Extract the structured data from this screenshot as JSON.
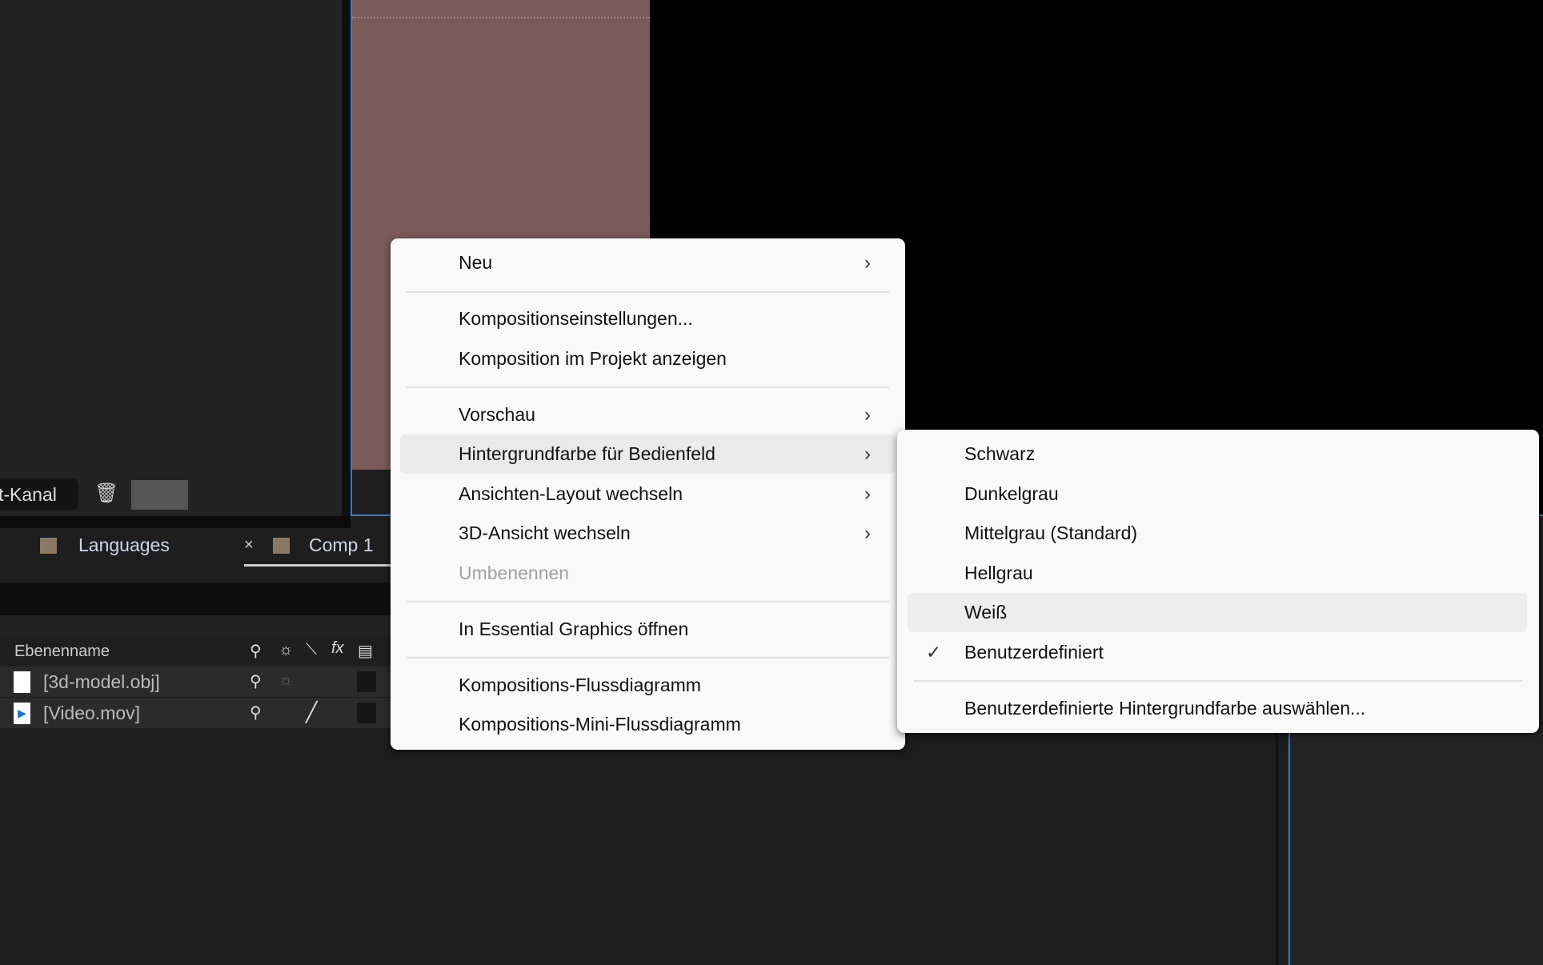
{
  "left_panel": {
    "channel_button": "t-Kanal",
    "trash_icon": "trash-icon"
  },
  "tabs": [
    {
      "label": "Languages",
      "color": "#8a7a63"
    },
    {
      "label": "Comp 1",
      "color": "#8a7a63",
      "close": "×",
      "active": true
    }
  ],
  "timeline": {
    "column_header": "Ebenenname",
    "layers": [
      {
        "name": "[3d-model.obj]",
        "icon": "file-icon"
      },
      {
        "name": "[Video.mov]",
        "icon": "video-file-icon"
      }
    ]
  },
  "context_menu": {
    "items": [
      {
        "label": "Neu",
        "submenu": true
      },
      {
        "label": "Kompositionseinstellungen..."
      },
      {
        "label": "Komposition im Projekt anzeigen"
      },
      {
        "label": "Vorschau",
        "submenu": true
      },
      {
        "label": "Hintergrundfarbe für Bedienfeld",
        "submenu": true,
        "highlighted": true
      },
      {
        "label": "Ansichten-Layout wechseln",
        "submenu": true
      },
      {
        "label": "3D-Ansicht wechseln",
        "submenu": true
      },
      {
        "label": "Umbenennen",
        "disabled": true
      },
      {
        "label": "In Essential Graphics öffnen"
      },
      {
        "label": "Kompositions-Flussdiagramm"
      },
      {
        "label": "Kompositions-Mini-Flussdiagramm"
      }
    ],
    "arrow": "›"
  },
  "submenu": {
    "items": [
      {
        "label": "Schwarz"
      },
      {
        "label": "Dunkelgrau"
      },
      {
        "label": "Mittelgrau (Standard)"
      },
      {
        "label": "Hellgrau"
      },
      {
        "label": "Weiß",
        "highlighted": true
      },
      {
        "label": "Benutzerdefiniert",
        "checked": true,
        "check": "✓"
      },
      {
        "label": "Benutzerdefinierte Hintergrundfarbe auswählen..."
      }
    ]
  },
  "colors": {
    "accent": "#2d7fd6",
    "comp_background": "#7b5a5a"
  }
}
